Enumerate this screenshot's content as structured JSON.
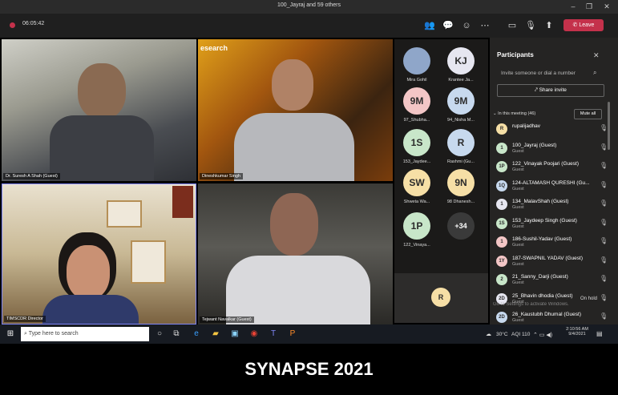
{
  "window": {
    "title": "100_Jayraj and 59 others"
  },
  "toolbar": {
    "timer": "06:05:42",
    "leave_label": "Leave"
  },
  "tiles": [
    {
      "name": "Dr. Suresh A Shah (Guest)"
    },
    {
      "name": "Dineshkumar Singh"
    },
    {
      "name": "TIMSCDR Director"
    },
    {
      "name": "Tejwant Navalkar (Guest)"
    }
  ],
  "tile_text": {
    "research": "esearch"
  },
  "gallery": [
    {
      "initials": "",
      "label": "Mira Gohil",
      "color": "#8fa6c9"
    },
    {
      "initials": "KJ",
      "label": "Krantee Ja...",
      "color": "#e6e6f0"
    },
    {
      "initials": "9M",
      "label": "97_Shubha...",
      "color": "#f3c6c6"
    },
    {
      "initials": "9M",
      "label": "94_Nisha M...",
      "color": "#c7d9ee"
    },
    {
      "initials": "1S",
      "label": "153_Jaydee...",
      "color": "#c8e6c9"
    },
    {
      "initials": "R",
      "label": "Rashmi (Gu...",
      "color": "#c7d9ee"
    },
    {
      "initials": "SW",
      "label": "Shweta Wa...",
      "color": "#f6dfa6"
    },
    {
      "initials": "9N",
      "label": "98 Dhanesh...",
      "color": "#f6dfa6"
    },
    {
      "initials": "1P",
      "label": "122_Vinaya...",
      "color": "#c8e6c9"
    },
    {
      "initials": "+34",
      "label": "",
      "color": "#3a3a3a"
    }
  ],
  "self_tile": {
    "initials": "R"
  },
  "panel": {
    "title": "Participants",
    "invite_placeholder": "Invite someone or dial a number",
    "share_invite": "Share invite",
    "in_meeting": "In this meeting (46)",
    "mute_all": "Mute all",
    "participants": [
      {
        "initials": "R",
        "name": "rupalijadhav",
        "sub": "",
        "color": "#f6dfa6"
      },
      {
        "initials": "1",
        "name": "100_Jayraj (Guest)",
        "sub": "Guest",
        "color": "#c8e6c9"
      },
      {
        "initials": "1P",
        "name": "122_Vinayak Poojari (Guest)",
        "sub": "Guest",
        "color": "#c8e6c9"
      },
      {
        "initials": "1Q",
        "name": "124-ALTAMASH QURESHI (Gu...",
        "sub": "Guest",
        "color": "#c7d9ee"
      },
      {
        "initials": "1",
        "name": "134_MalavShah (Guest)",
        "sub": "Guest",
        "color": "#e6e6f0"
      },
      {
        "initials": "1S",
        "name": "153_Jaydeep Singh (Guest)",
        "sub": "Guest",
        "color": "#c8e6c9"
      },
      {
        "initials": "1",
        "name": "186-Sushil-Yadav (Guest)",
        "sub": "Guest",
        "color": "#f3c6c6"
      },
      {
        "initials": "1Y",
        "name": "187-SWAPNIL YADAV (Guest)",
        "sub": "Guest",
        "color": "#f3c6c6"
      },
      {
        "initials": "2",
        "name": "21_Sanny_Darji (Guest)",
        "sub": "Guest",
        "color": "#c8e6c9"
      },
      {
        "initials": "2D",
        "name": "25_Bhavin dhodia (Guest)",
        "sub": "Guest",
        "color": "#e6e6f0"
      },
      {
        "initials": "2D",
        "name": "26_Kaustubh Dhumal (Guest)",
        "sub": "Guest",
        "color": "#c7d9ee"
      }
    ],
    "on_hold": "On hold",
    "activate": "Go to Settings to activate Windows."
  },
  "taskbar": {
    "search_placeholder": "Type here to search",
    "weather": "30°C",
    "aqi": "AQI 110",
    "time": "2:10:56 AM",
    "date": "9/4/2021"
  },
  "caption": "SYNAPSE 2021"
}
